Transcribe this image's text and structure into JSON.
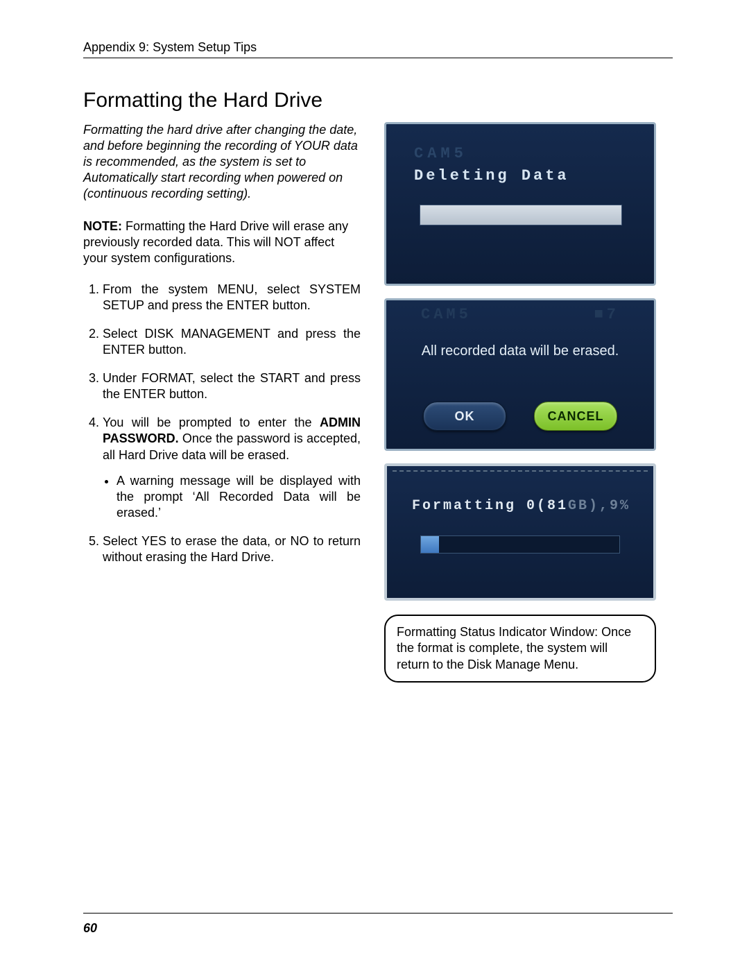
{
  "header": {
    "breadcrumb": "Appendix 9: System Setup Tips"
  },
  "title": "Formatting the Hard Drive",
  "intro": "Formatting the hard drive after changing the date, and before beginning the recording of YOUR data is recommended, as the system is set to Automatically start recording when powered on (continuous recording setting).",
  "note_prefix": "NOTE:",
  "note_body": " Formatting the Hard Drive will erase any previously recorded data. This will NOT affect your system configurations.",
  "steps": {
    "s1": "From the system MENU, select SYSTEM SETUP and press the ENTER button.",
    "s2": "Select DISK MANAGEMENT and press the ENTER button.",
    "s3": "Under FORMAT, select the START and press the ENTER button.",
    "s4a": "You will be prompted to enter the ",
    "s4b_bold": "ADMIN PASSWORD.",
    "s4c": " Once the password is accepted, all Hard Drive data will be erased.",
    "s4_bullet": "A warning message will be displayed with the prompt ‘All Recorded Data will be erased.’",
    "s5": "Select YES to erase the data, or NO to return without erasing the Hard Drive."
  },
  "panel1": {
    "ghost": "CAM5",
    "label": "Deleting Data"
  },
  "panel2": {
    "ghost_left": "CAM5",
    "ghost_right": "■7",
    "warning": "All recorded data will be erased.",
    "ok": "OK",
    "cancel": "CANCEL"
  },
  "panel3": {
    "label_prefix": "Formatting 0(81",
    "label_faded": "GB),9%",
    "progress_percent": 9
  },
  "callout": "Formatting Status Indicator Window: Once the format is complete, the system will return to the Disk Manage Menu.",
  "page_number": "60"
}
